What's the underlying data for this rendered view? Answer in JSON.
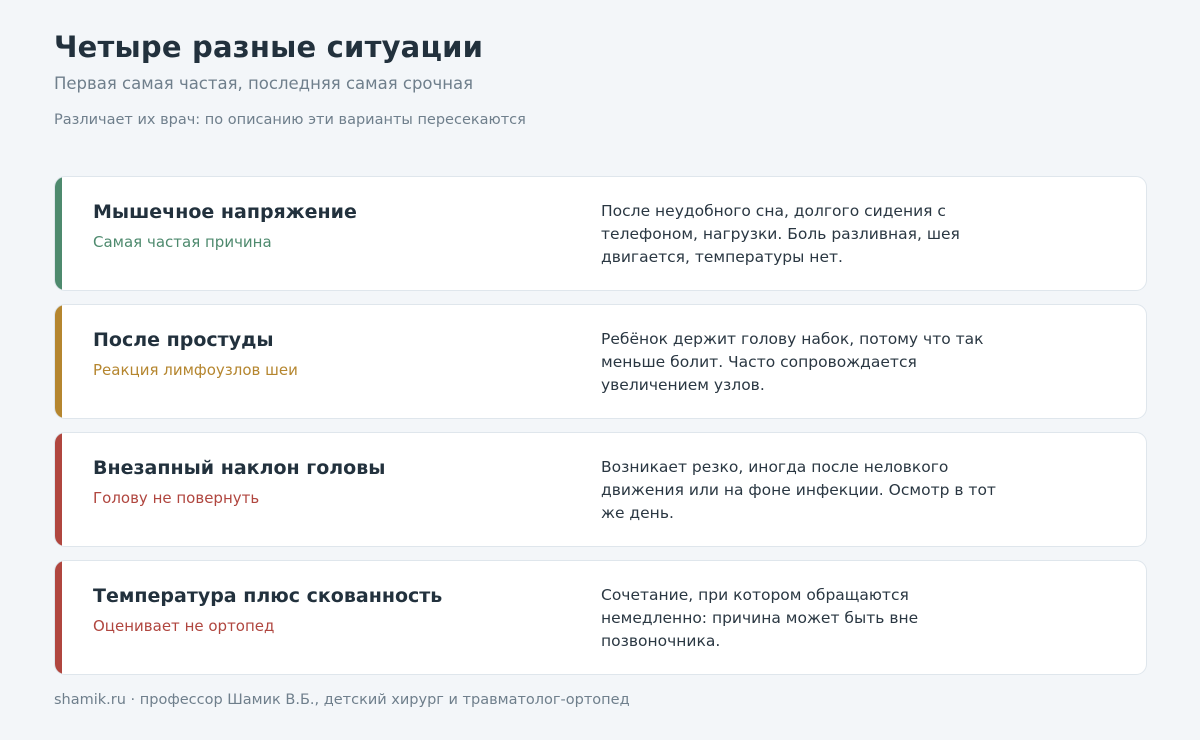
{
  "header": {
    "title": "Четыре разные ситуации",
    "subtitle": "Первая самая частая, последняя самая срочная",
    "note": "Различает их врач: по описанию эти варианты пересекаются"
  },
  "colors": {
    "green": "#4e8a6e",
    "amber": "#b5862f",
    "red": "#b0463f"
  },
  "cards": [
    {
      "title": "Мышечное напряжение",
      "tag": "Самая частая причина",
      "description": "После неудобного сна, долгого сидения с телефоном, нагрузки. Боль разливная, шея двигается, температуры нет.",
      "accent": "#4e8a6e"
    },
    {
      "title": "После простуды",
      "tag": "Реакция лимфоузлов шеи",
      "description": "Ребёнок держит голову набок, потому что так меньше болит. Часто сопровождается увеличением узлов.",
      "accent": "#b5862f"
    },
    {
      "title": "Внезапный наклон головы",
      "tag": "Голову не повернуть",
      "description": "Возникает резко, иногда после неловкого движения или на фоне инфекции. Осмотр в тот же день.",
      "accent": "#b0463f"
    },
    {
      "title": "Температура плюс скованность",
      "tag": "Оценивает не ортопед",
      "description": "Сочетание, при котором обращаются немедленно: причина может быть вне позвоночника.",
      "accent": "#b0463f"
    }
  ],
  "footer": {
    "text": "shamik.ru · профессор Шамик В.Б., детский хирург и травматолог-ортопед"
  }
}
